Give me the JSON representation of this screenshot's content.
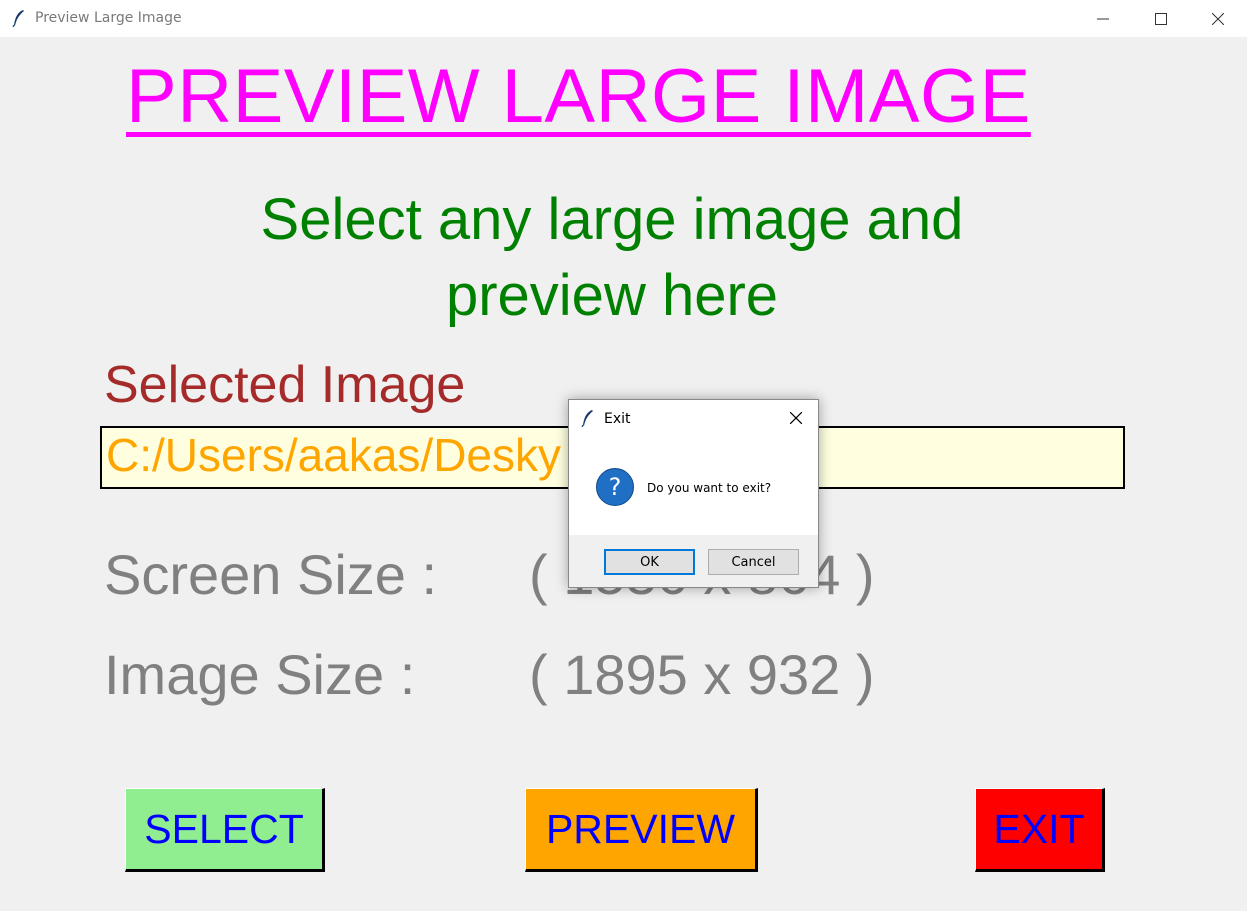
{
  "window": {
    "title": "Preview Large Image",
    "app_icon": "feather-icon",
    "controls": [
      "minimize-icon",
      "maximize-icon",
      "close-icon"
    ]
  },
  "main": {
    "heading": "PREVIEW LARGE IMAGE",
    "subtitle_line1": "Select any large image and",
    "subtitle_line2": "preview here",
    "selected_label": "Selected Image",
    "path_value": "C:/Users/aakas/Desky",
    "screen_size_label": "Screen Size  :",
    "screen_size_value": "( 1536 x 864 )",
    "image_size_label": "Image Size  :",
    "image_size_value": "( 1895 x 932 )"
  },
  "buttons": {
    "select": "SELECT",
    "preview": "PREVIEW",
    "exit": "EXIT"
  },
  "dialog": {
    "title": "Exit",
    "message": "Do you want to exit?",
    "icon": "question-icon",
    "ok": "OK",
    "cancel": "Cancel"
  },
  "colors": {
    "heading": "#ff00ff",
    "subtitle": "#008000",
    "selected_label": "#a52a2a",
    "path_text": "#ffa500",
    "path_bg": "#ffffe0",
    "info_text": "#808080",
    "select_bg": "#90ee90",
    "preview_bg": "#ffa500",
    "exit_bg": "#ff0000",
    "button_text": "#0000ff"
  }
}
